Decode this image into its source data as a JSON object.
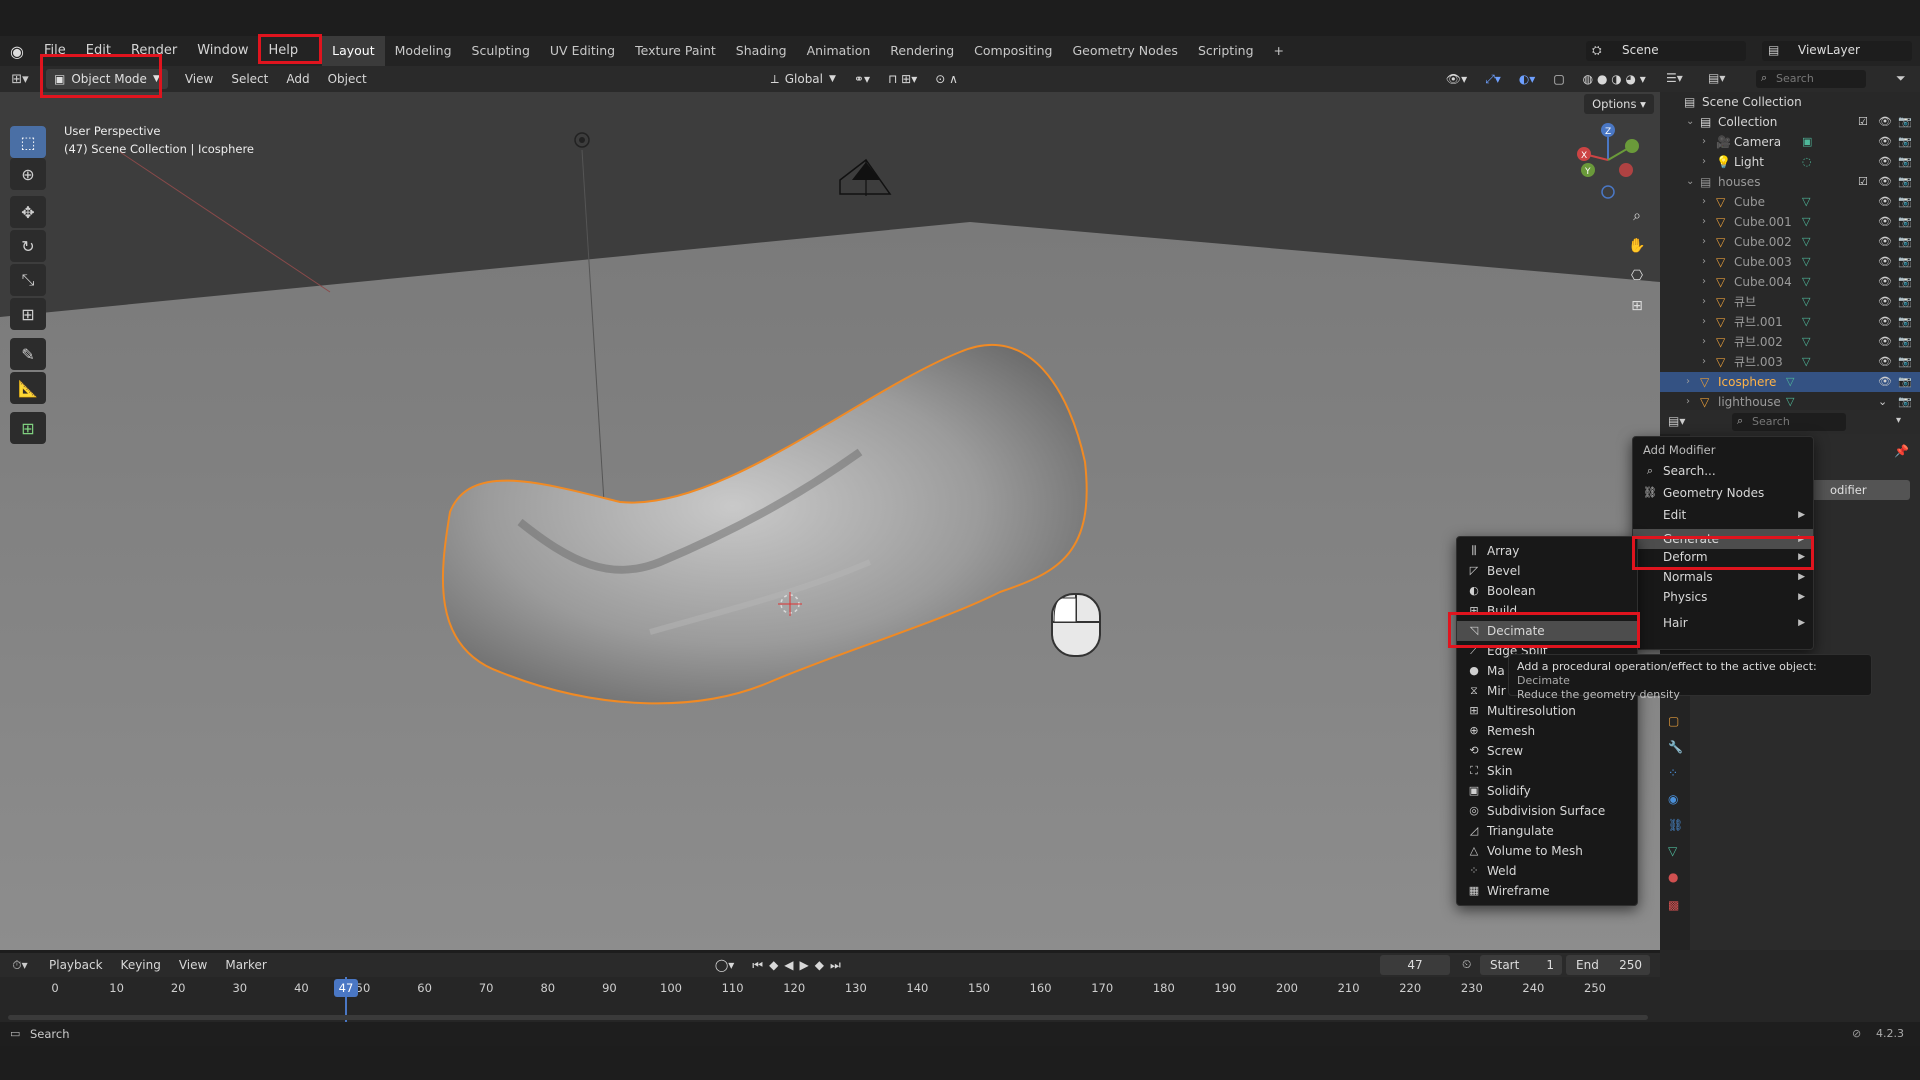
{
  "topbar": {
    "menus": [
      "File",
      "Edit",
      "Render",
      "Window",
      "Help"
    ],
    "workspaces": [
      "Layout",
      "Modeling",
      "Sculpting",
      "UV Editing",
      "Texture Paint",
      "Shading",
      "Animation",
      "Rendering",
      "Compositing",
      "Geometry Nodes",
      "Scripting"
    ],
    "add_tab": "+",
    "scene": "Scene",
    "view_layer": "ViewLayer"
  },
  "viewport_header": {
    "mode": "Object Mode",
    "menus": [
      "View",
      "Select",
      "Add",
      "Object"
    ],
    "orientation": "Global",
    "options": "Options"
  },
  "viewport": {
    "perspective": "User Perspective",
    "collection_info": "(47) Scene Collection | Icosphere"
  },
  "outliner": {
    "search_placeholder": "Search",
    "rows": [
      {
        "label": "Scene Collection"
      },
      {
        "label": "Collection"
      },
      {
        "label": "Camera"
      },
      {
        "label": "Light"
      },
      {
        "label": "houses"
      },
      {
        "label": "Cube"
      },
      {
        "label": "Cube.001"
      },
      {
        "label": "Cube.002"
      },
      {
        "label": "Cube.003"
      },
      {
        "label": "Cube.004"
      },
      {
        "label": "큐브"
      },
      {
        "label": "큐브.001"
      },
      {
        "label": "큐브.002"
      },
      {
        "label": "큐브.003"
      },
      {
        "label": "Icosphere"
      },
      {
        "label": "lighthouse"
      }
    ]
  },
  "properties": {
    "search_placeholder": "Search",
    "add_modifier_fragment": "odifier"
  },
  "add_modifier_menu": {
    "title": "Add Modifier",
    "items": [
      {
        "label": "Search...",
        "icon": "search-icon"
      },
      {
        "label": "Geometry Nodes",
        "icon": "nodes-icon"
      },
      {
        "label": "Edit",
        "icon": ""
      },
      {
        "label": "Generate",
        "icon": ""
      },
      {
        "label": "Deform",
        "icon": ""
      },
      {
        "label": "Normals",
        "icon": ""
      },
      {
        "label": "Physics",
        "icon": ""
      },
      {
        "label": "Hair",
        "icon": ""
      }
    ]
  },
  "generate_menu": {
    "items": [
      "Array",
      "Bevel",
      "Boolean",
      "Build",
      "Decimate",
      "Edge Split",
      "Mask",
      "Mirror",
      "Multiresolution",
      "Remesh",
      "Screw",
      "Skin",
      "Solidify",
      "Subdivision Surface",
      "Triangulate",
      "Volume to Mesh",
      "Weld",
      "Wireframe"
    ],
    "visible_labels": [
      "Array",
      "Bevel",
      "Boolean",
      "Build",
      "Decimate",
      "Edge Split",
      "Ma",
      "Mir",
      "Multiresolution",
      "Remesh",
      "Screw",
      "Skin",
      "Solidify",
      "Subdivision Surface",
      "Triangulate",
      "Volume to Mesh",
      "Weld",
      "Wireframe"
    ]
  },
  "tooltip": {
    "line1": "Add a procedural operation/effect to the active object:",
    "name": "Decimate",
    "line2": "Reduce the geometry density"
  },
  "timeline": {
    "menus": [
      "Playback",
      "Keying",
      "View",
      "Marker"
    ],
    "current_frame": "47",
    "start_label": "Start",
    "start": "1",
    "end_label": "End",
    "end": "250",
    "ticks": [
      "0",
      "10",
      "20",
      "30",
      "40",
      "50",
      "60",
      "70",
      "80",
      "90",
      "100",
      "110",
      "120",
      "130",
      "140",
      "150",
      "160",
      "170",
      "180",
      "190",
      "200",
      "210",
      "220",
      "230",
      "240",
      "250"
    ]
  },
  "statusbar": {
    "search": "Search",
    "version": "4.2.3"
  },
  "colors": {
    "selection_outline": "#f08a24",
    "highlight_box": "#e0141e",
    "outliner_selected": "#345283",
    "playhead": "#4a77c4"
  }
}
